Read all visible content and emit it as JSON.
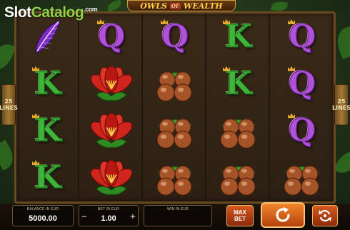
{
  "watermark": {
    "slot": "Slot",
    "catalog": "Catalog",
    "com": ".com"
  },
  "title": {
    "left": "OWLS",
    "of": "OF",
    "right": "WEALTH"
  },
  "paylines": {
    "left": "25\nLINES",
    "right": "25\nLINES"
  },
  "reels": [
    [
      "feather",
      "K",
      "K",
      "K"
    ],
    [
      "Q",
      "flower",
      "flower",
      "flower"
    ],
    [
      "Q",
      "nuts",
      "nuts",
      "nuts"
    ],
    [
      "K",
      "K",
      "nuts",
      "nuts"
    ],
    [
      "Q",
      "Q",
      "Q",
      "nuts"
    ]
  ],
  "panel": {
    "balance_label": "BALANCE IN EUR",
    "balance_value": "5000.00",
    "bet_label": "BET IN EUR",
    "bet_value": "1.00",
    "bet_minus": "−",
    "bet_plus": "+",
    "win_label": "WIN IN EUR",
    "win_value": "",
    "max_bet_label": "MAX\nBET"
  },
  "icons": {
    "spin": "spin-arrow-icon",
    "autoplay": "autoplay-icon"
  },
  "colors": {
    "k_symbol": "#3fb43a",
    "q_symbol": "#b052d8",
    "spin_button": "#f2862a",
    "frame": "#6b4a1f"
  }
}
